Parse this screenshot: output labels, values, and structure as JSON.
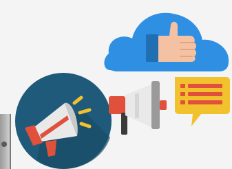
{
  "illustration": {
    "cloud_color": "#2f8fe3",
    "thumb_color": "#f4c1a3",
    "cuff_color": "#1f6fb2",
    "badge_color": "#1f5a7a",
    "megaphone_color": "#e9e9e9",
    "megaphone_accent": "#e0503a",
    "spark_color": "#f2c12e",
    "chat_color": "#f2c12e",
    "chat_line_color": "#e0503a"
  }
}
